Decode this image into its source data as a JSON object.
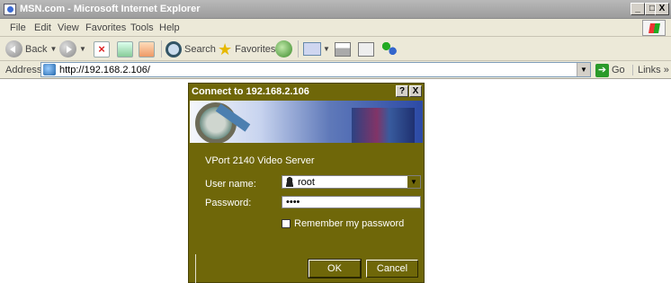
{
  "browser": {
    "title": "MSN.com - Microsoft Internet Explorer",
    "window_buttons": {
      "minimize": "_",
      "maximize": "□",
      "close": "X"
    },
    "menu": [
      "File",
      "Edit",
      "View",
      "Favorites",
      "Tools",
      "Help"
    ],
    "toolbar": {
      "back_label": "Back",
      "search_label": "Search",
      "favorites_label": "Favorites"
    },
    "address": {
      "label": "Address",
      "url": "http://192.168.2.106/",
      "go_label": "Go",
      "links_label": "Links »"
    }
  },
  "dialog": {
    "title": "Connect to 192.168.2.106",
    "help_btn": "?",
    "close_btn": "X",
    "server_name": "VPort 2140 Video Server",
    "username_label": "User name:",
    "username_value": "root",
    "password_label": "Password:",
    "password_value": "••••",
    "remember_label": "Remember my password",
    "remember_checked": false,
    "ok_label": "OK",
    "cancel_label": "Cancel",
    "colors": {
      "dialog_bg": "#6f6709",
      "banner_right": "#2c4aa6"
    }
  }
}
